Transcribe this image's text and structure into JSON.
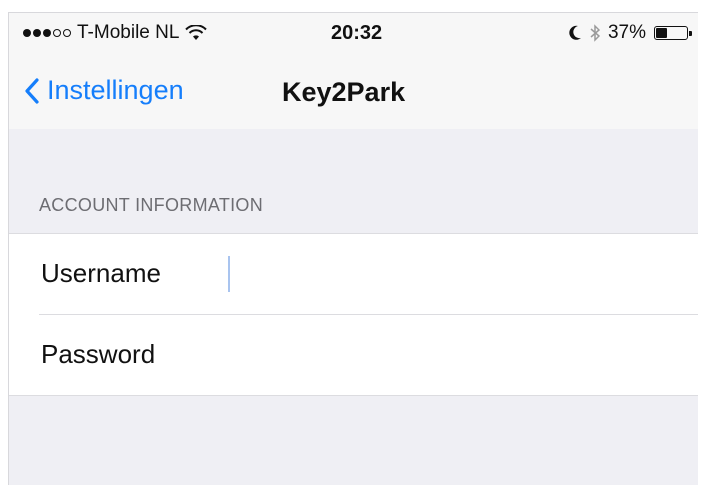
{
  "status_bar": {
    "carrier": "T-Mobile NL",
    "signal_filled": 3,
    "signal_total": 5,
    "time": "20:32",
    "battery_percent_text": "37%",
    "battery_level": 0.37
  },
  "nav": {
    "back_label": "Instellingen",
    "title": "Key2Park"
  },
  "account": {
    "section_header": "ACCOUNT INFORMATION",
    "username_label": "Username",
    "username_value": "",
    "password_label": "Password",
    "password_value": ""
  },
  "colors": {
    "accent": "#157efb",
    "background": "#efeff4",
    "section_header": "#6d6d72"
  },
  "icons": {
    "wifi": "wifi-icon",
    "moon": "moon-icon",
    "bluetooth": "bluetooth-icon",
    "battery": "battery-icon",
    "back": "chevron-left-icon"
  }
}
